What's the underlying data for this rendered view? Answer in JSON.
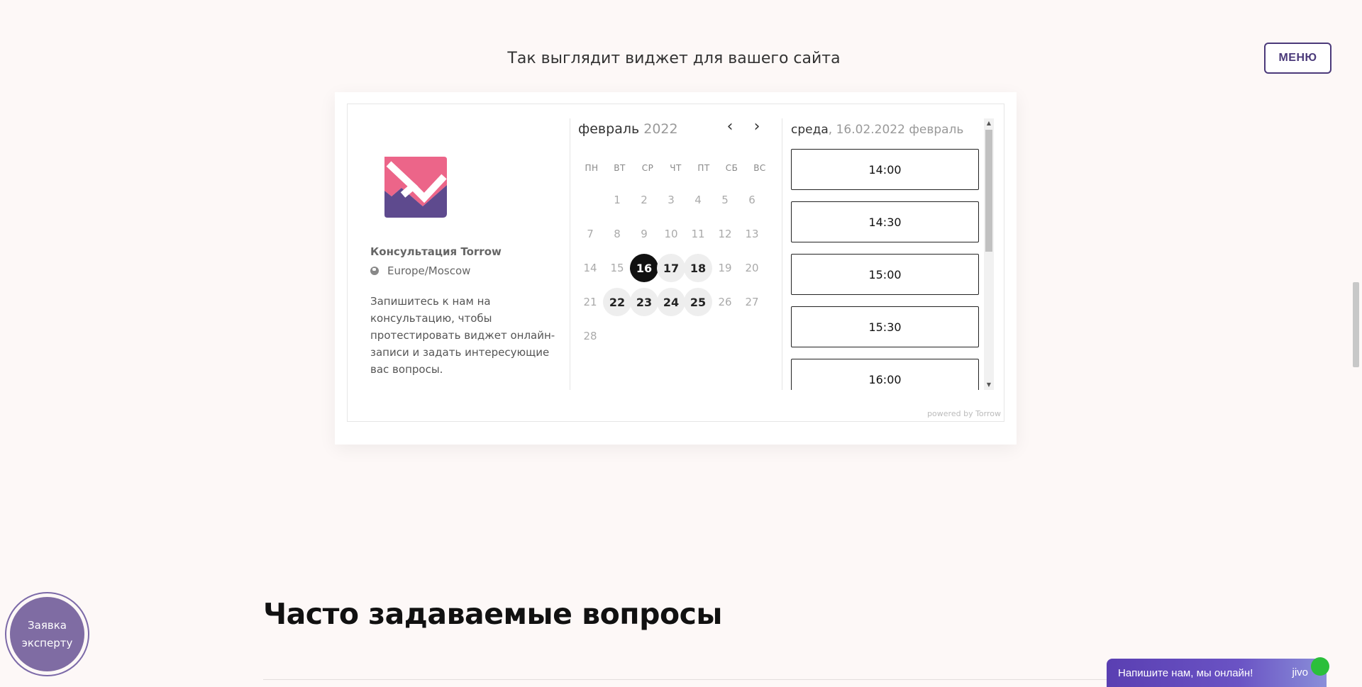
{
  "section": {
    "title": "Так выглядит виджет для вашего сайта"
  },
  "menu": {
    "label": "МЕНЮ"
  },
  "widget": {
    "event_name": "Консультация Torrow",
    "timezone": "Europe/Moscow",
    "description": "Запишитесь к нам на консультацию, чтобы протестировать виджет онлайн-записи и задать интересующие вас вопросы.",
    "calendar": {
      "month": "февраль",
      "year": "2022",
      "prev_icon": "chevron-left-icon",
      "next_icon": "chevron-right-icon",
      "weekdays": [
        "ПН",
        "ВТ",
        "СР",
        "ЧТ",
        "ПТ",
        "СБ",
        "ВС"
      ],
      "weeks": [
        [
          "",
          "1",
          "2",
          "3",
          "4",
          "5",
          "6"
        ],
        [
          "7",
          "8",
          "9",
          "10",
          "11",
          "12",
          "13"
        ],
        [
          "14",
          "15",
          "16",
          "17",
          "18",
          "19",
          "20"
        ],
        [
          "21",
          "22",
          "23",
          "24",
          "25",
          "26",
          "27"
        ],
        [
          "28",
          "",
          "",
          "",
          "",
          "",
          ""
        ]
      ],
      "available_days": [
        "17",
        "18",
        "22",
        "23",
        "24",
        "25"
      ],
      "selected_day": "16"
    },
    "times": {
      "weekday": "среда",
      "date_text": "16.02.2022 февраль",
      "slots": [
        "14:00",
        "14:30",
        "15:00",
        "15:30",
        "16:00"
      ]
    },
    "powered": "powered by Torrow"
  },
  "faq": {
    "title": "Часто задаваемые вопросы"
  },
  "expert_button": {
    "line1": "Заявка",
    "line2": "эксперту"
  },
  "chat": {
    "label": "Напишите нам, мы онлайн!",
    "brand": "jivo"
  },
  "colors": {
    "accent": "#4b3a7a",
    "selected": "#111111",
    "available": "#eeeeee",
    "chat": "#5a3fb2"
  }
}
